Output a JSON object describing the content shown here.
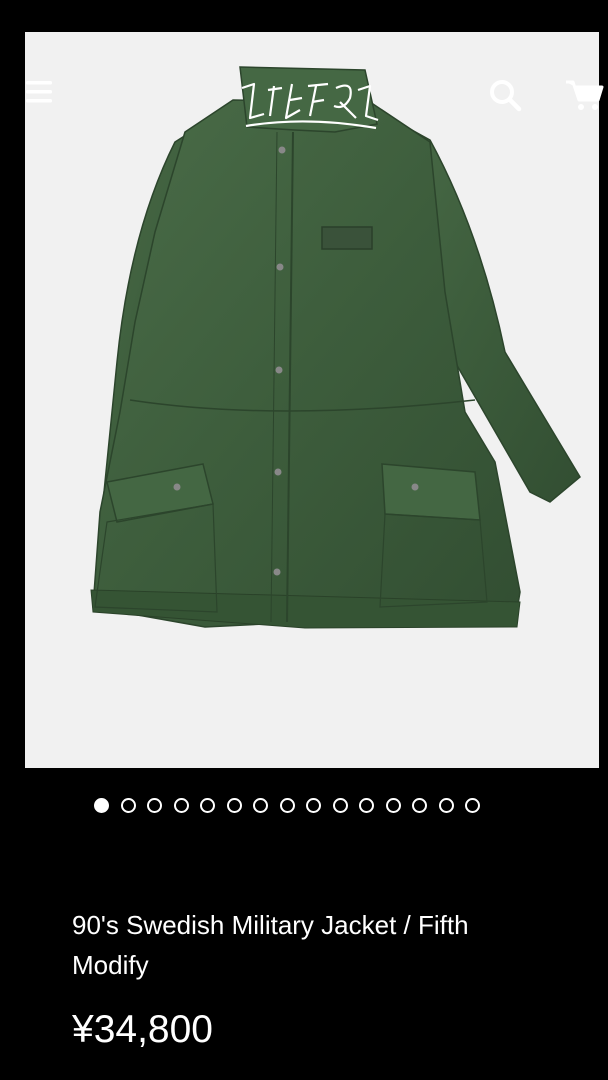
{
  "header": {
    "menu_icon": "hamburger-menu-icon",
    "logo_icon": "brand-logo",
    "search_icon": "search-icon",
    "cart_icon": "cart-icon",
    "icon_color": "#ffffff"
  },
  "gallery": {
    "image_subject": "green military parka jacket",
    "background_color": "#f1f1f1",
    "jacket_color": "#3e5e3d",
    "dot_count": 15,
    "active_index": 0
  },
  "product": {
    "title": "90's Swedish Military Jacket / Fifth Modify",
    "price": "¥34,800"
  }
}
